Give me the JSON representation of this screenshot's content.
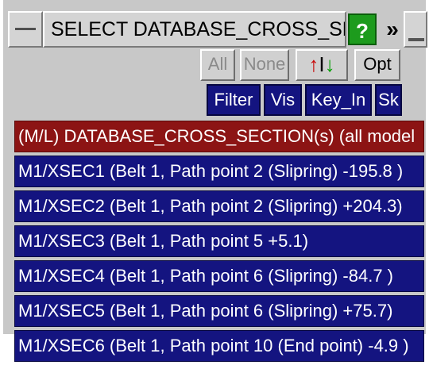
{
  "window": {
    "title": "SELECT DATABASE_CROSS_SECTI",
    "help_label": "?",
    "more_label": "»"
  },
  "toolbar": {
    "all_label": "All",
    "none_label": "None",
    "sort_up": "↑",
    "sort_mid": "I",
    "sort_down": "↓",
    "opt_label": "Opt",
    "filter_label": "Filter",
    "vis_label": "Vis",
    "keyin_label": "Key_In",
    "sk_label": "Sk"
  },
  "list": {
    "header": "(M/L) DATABASE_CROSS_SECTION(s) (all model",
    "items": [
      "M1/XSEC1 (Belt 1, Path point 2 (Slipring) -195.8 )",
      "M1/XSEC2 (Belt 1, Path point 2 (Slipring) +204.3)",
      "M1/XSEC3 (Belt 1, Path point 5 +5.1)",
      "M1/XSEC4 (Belt 1, Path point 6 (Slipring) -84.7 )",
      "M1/XSEC5 (Belt 1, Path point 6 (Slipring) +75.7)",
      "M1/XSEC6 (Belt 1, Path point 10 (End point) -4.9 )"
    ]
  },
  "colors": {
    "panel_bg": "#c8c8c8",
    "item_bg": "#141480",
    "header_bg": "#8c1414",
    "help_bg": "#1d9b1d"
  }
}
